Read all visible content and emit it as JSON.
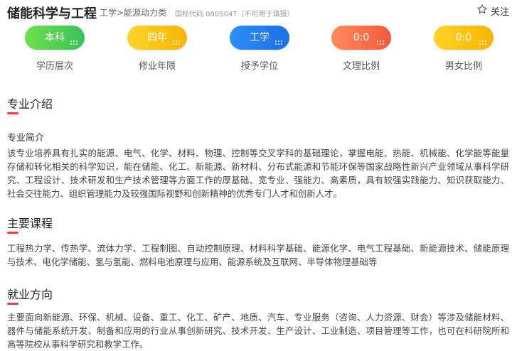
{
  "header": {
    "title": "储能科学与工程",
    "category": "工学>能源动力类",
    "code": "国标代码 080504T（不可用于填报）",
    "follow_label": "关注",
    "follow_icon": "star-outline-icon"
  },
  "stats": [
    {
      "value": "本科",
      "label": "学历层次",
      "color": "#39c25c"
    },
    {
      "value": "四年",
      "label": "修业年限",
      "color": "#f6b400"
    },
    {
      "value": "工学",
      "label": "授予学位",
      "color": "#1b6ee8"
    },
    {
      "value": "0:0",
      "label": "文理比例",
      "color": "#f45a3c"
    },
    {
      "value": "0:0",
      "label": "男女比例",
      "color": "#f6b400"
    }
  ],
  "intro": {
    "title": "专业介绍",
    "subtitle": "专业简介",
    "text": "该专业培养具有扎实的能源、电气、化学、材料、物理、控制等交叉学科的基础理论，掌握电能、热能、机械能、化学能等能量存储和转化相关的科学知识，能在储能、化工、新能源、新材料、分布式能源和节能环保等国家战略性新兴产业领域从事科学研究、工程设计、技术研发和生产技术管理等方面工作的厚基础、宽专业、强能力、高素质，具有较强实践能力、知识获取能力、社会交往能力、组织管理能力及较强国际视野和创新精神的优秀专门人才和创新人才。"
  },
  "courses": {
    "title": "主要课程",
    "text": "工程热力学、传热学、流体力学、工程制图、自动控制原理、材料科学基础、能源化学、电气工程基础、新能源技术、储能原理与技术、电化学储能、氢与氢能、燃料电池原理与应用、能源系统及互联网、半导体物理基础等"
  },
  "career": {
    "title": "就业方向",
    "text": "主要面向新能源、环保、机械、设备、重工、化工、矿产、地质、汽车、专业服务（咨询、人力资源、财会）等涉及储能材料、器件与储能系统开发、制备和应用的行业从事创新研究、技术开发、生产设计、工业制造、项目管理等工作，也可在科研院所和高等院校从事科学研究和教学工作。"
  },
  "accent": "#f23c3c"
}
